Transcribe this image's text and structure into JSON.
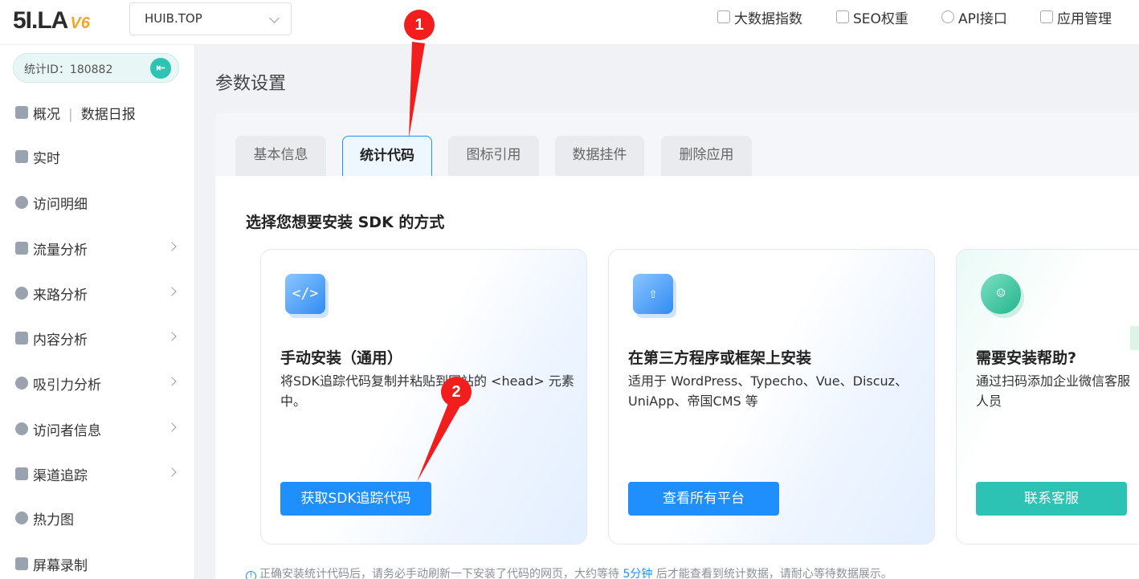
{
  "app": {
    "logo_main": "5I.LA",
    "logo_version": "V6"
  },
  "site_select": {
    "value": "HUIB.TOP"
  },
  "topnav": [
    {
      "label": "大数据指数",
      "icon": "chart-icon"
    },
    {
      "label": "SEO权重",
      "icon": "image-icon"
    },
    {
      "label": "API接口",
      "icon": "link-icon"
    },
    {
      "label": "应用管理",
      "icon": "cube-icon"
    }
  ],
  "sidebar": {
    "stat_id": "统计ID：180882",
    "items": [
      {
        "label": "概况",
        "extra": "数据日报",
        "icon": "home-icon"
      },
      {
        "label": "实时",
        "icon": "watch-icon"
      },
      {
        "label": "访问明细",
        "icon": "disc-icon"
      },
      {
        "label": "流量分析",
        "icon": "monitor-icon"
      },
      {
        "label": "来路分析",
        "icon": "dots-icon"
      },
      {
        "label": "内容分析",
        "icon": "content-icon"
      },
      {
        "label": "吸引力分析",
        "icon": "pie-icon"
      },
      {
        "label": "访问者信息",
        "icon": "chat-icon"
      },
      {
        "label": "渠道追踪",
        "icon": "channel-icon"
      },
      {
        "label": "热力图",
        "icon": "heatmap-icon"
      },
      {
        "label": "屏幕录制",
        "icon": "record-icon"
      }
    ]
  },
  "main": {
    "page_title": "参数设置",
    "tabs": [
      {
        "label": "基本信息"
      },
      {
        "label": "统计代码"
      },
      {
        "label": "图标引用"
      },
      {
        "label": "数据挂件"
      },
      {
        "label": "删除应用"
      }
    ],
    "active_tab": "统计代码",
    "sdk_title": "选择您想要安装 SDK 的方式",
    "cards": [
      {
        "icon": "code-file-icon",
        "title": "手动安装（通用）",
        "desc": "将SDK追踪代码复制并粘贴到网站的 <head> 元素中。",
        "button": "获取SDK追踪代码"
      },
      {
        "icon": "upload-icon",
        "title": "在第三方程序或框架上安装",
        "desc": "适用于 WordPress、Typecho、Vue、Discuz、UniApp、帝国CMS 等",
        "button": "查看所有平台"
      },
      {
        "icon": "support-icon",
        "title": "需要安装帮助?",
        "desc": "通过扫码添加企业微信客服人员",
        "button": "联系客服"
      }
    ],
    "footnote": {
      "before": "正确安装统计代码后，请务必手动刷新一下安装了代码的网页，大约等待 ",
      "highlight": "5分钟",
      "after": " 后才能查看到统计数据，请耐心等待数据展示。"
    }
  },
  "annotations": [
    {
      "label": "1"
    },
    {
      "label": "2"
    }
  ],
  "colors": {
    "primary": "#1e8ffc",
    "teal": "#2cc2b4",
    "marker": "#f21d1d",
    "logo_accent": "#f2a623"
  }
}
